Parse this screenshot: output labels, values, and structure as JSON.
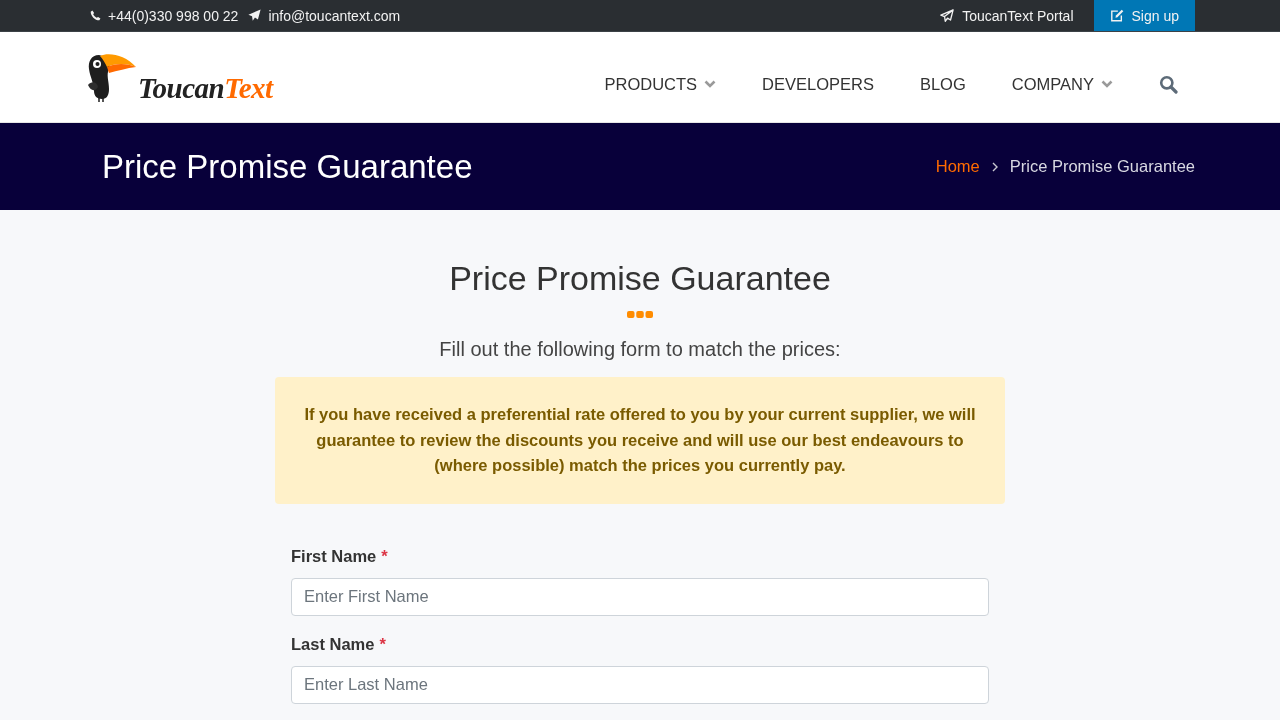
{
  "top_bar": {
    "phone": "+44(0)330 998 00 22",
    "email": "info@toucantext.com",
    "portal_link": "ToucanText Portal",
    "signup_button": "Sign up"
  },
  "header": {
    "logo": {
      "text_1": "Toucan",
      "text_2": "Text"
    },
    "nav": [
      {
        "label": "PRODUCTS",
        "has_dropdown": true
      },
      {
        "label": "DEVELOPERS",
        "has_dropdown": false
      },
      {
        "label": "BLOG",
        "has_dropdown": false
      },
      {
        "label": "COMPANY",
        "has_dropdown": true
      }
    ]
  },
  "page_banner": {
    "title": "Price Promise Guarantee",
    "breadcrumb": [
      {
        "label": "Home",
        "kind": "link"
      },
      {
        "label": "Price Promise Guarantee",
        "kind": "current"
      }
    ]
  },
  "content": {
    "heading": "Price Promise Guarantee",
    "subheading": "Fill out the following form to match the prices:",
    "notice": "If you have received a preferential rate offered to you by your current supplier, we will guarantee to review the discounts you receive and will use our best endeavours to (where possible) match the prices you currently pay.",
    "form_fields": [
      {
        "label": "First Name",
        "required_mark": "*",
        "placeholder": "Enter First Name"
      },
      {
        "label": "Last Name",
        "required_mark": "*",
        "placeholder": "Enter Last Name"
      }
    ]
  }
}
